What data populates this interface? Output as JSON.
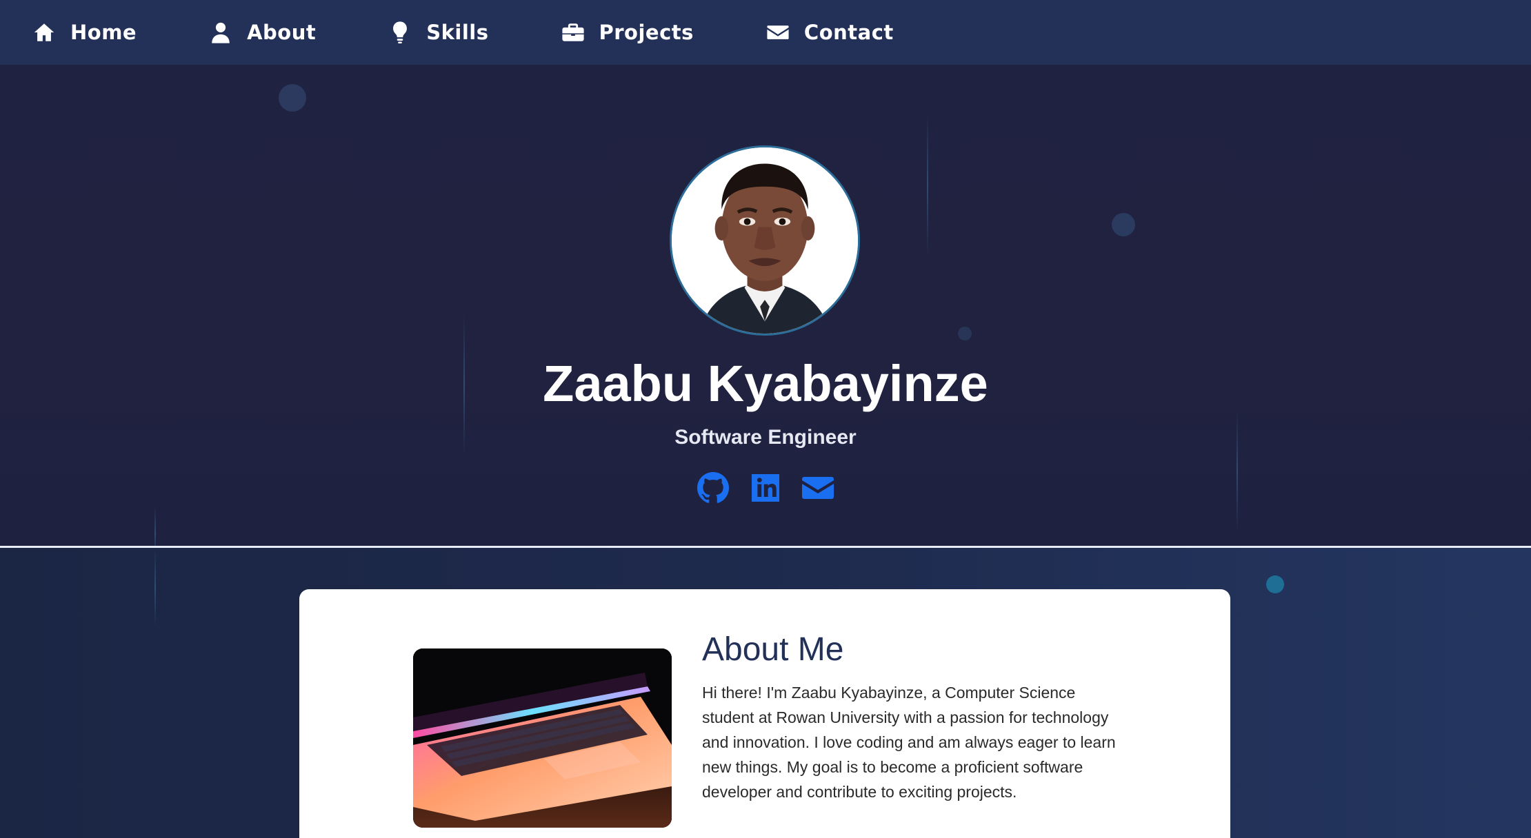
{
  "nav": {
    "items": [
      {
        "label": "Home",
        "icon": "home-icon"
      },
      {
        "label": "About",
        "icon": "user-icon"
      },
      {
        "label": "Skills",
        "icon": "lightbulb-icon"
      },
      {
        "label": "Projects",
        "icon": "briefcase-icon"
      },
      {
        "label": "Contact",
        "icon": "envelope-icon"
      }
    ]
  },
  "hero": {
    "name": "Zaabu Kyabayinze",
    "role": "Software Engineer",
    "socials": [
      {
        "icon": "github-icon"
      },
      {
        "icon": "linkedin-icon"
      },
      {
        "icon": "envelope-icon"
      }
    ]
  },
  "about": {
    "title": "About Me",
    "text": "Hi there! I'm Zaabu Kyabayinze, a Computer Science student at Rowan University with a passion for technology and innovation. I love coding and am always eager to learn new things. My goal is to become a proficient software developer and contribute to exciting projects."
  },
  "colors": {
    "nav_bg": "#233158",
    "hero_bg": "#1f2240",
    "accent": "#1a6ff0",
    "avatar_ring": "#2c6d99",
    "title_color": "#233158"
  }
}
